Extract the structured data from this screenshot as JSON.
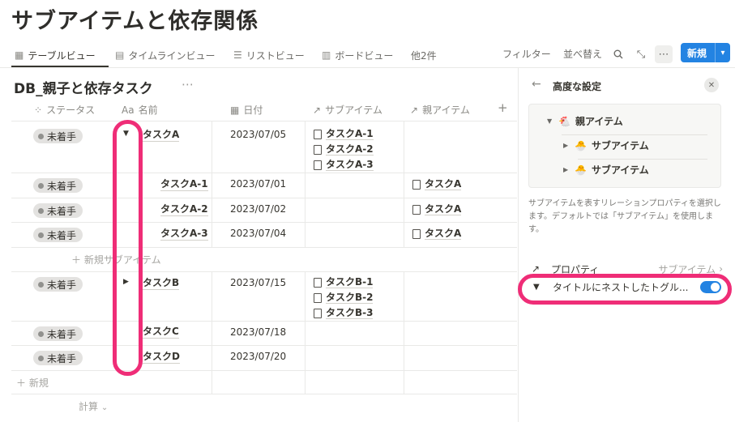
{
  "page": {
    "title": "サブアイテムと依存関係"
  },
  "views": {
    "tabs": [
      {
        "label": "テーブルビュー",
        "icon": "table-icon",
        "active": true
      },
      {
        "label": "タイムラインビュー",
        "icon": "timeline-icon"
      },
      {
        "label": "リストビュー",
        "icon": "list-icon"
      },
      {
        "label": "ボードビュー",
        "icon": "board-icon"
      }
    ],
    "more_views": "他2件",
    "filter_label": "フィルター",
    "sort_label": "並べ替え",
    "new_button_label": "新規"
  },
  "database": {
    "title": "DB_親子と依存タスク",
    "columns": [
      {
        "label": "ステータス",
        "icon": "status-icon"
      },
      {
        "label": "名前",
        "icon": "Aa"
      },
      {
        "label": "日付",
        "icon": "calendar-icon"
      },
      {
        "label": "サブアイテム",
        "icon": "relation-arrow-icon"
      },
      {
        "label": "親アイテム",
        "icon": "relation-arrow-icon"
      }
    ],
    "rows": [
      {
        "status": "未着手",
        "name": "タスクA",
        "date": "2023/07/05",
        "sub_items": [
          "タスクA-1",
          "タスクA-2",
          "タスクA-3"
        ],
        "parent": ""
      },
      {
        "status": "未着手",
        "name": "タスクA-1",
        "date": "2023/07/01",
        "sub_items": [],
        "parent": "タスクA"
      },
      {
        "status": "未着手",
        "name": "タスクA-2",
        "date": "2023/07/02",
        "sub_items": [],
        "parent": "タスクA"
      },
      {
        "status": "未着手",
        "name": "タスクA-3",
        "date": "2023/07/04",
        "sub_items": [],
        "parent": "タスクA"
      },
      {
        "status": "未着手",
        "name": "タスクB",
        "date": "2023/07/15",
        "sub_items": [
          "タスクB-1",
          "タスクB-2",
          "タスクB-3"
        ],
        "parent": ""
      },
      {
        "status": "未着手",
        "name": "タスクC",
        "date": "2023/07/18",
        "sub_items": [],
        "parent": ""
      },
      {
        "status": "未着手",
        "name": "タスクD",
        "date": "2023/07/20",
        "sub_items": [],
        "parent": ""
      }
    ],
    "new_sub_item_label": "新規サブアイテム",
    "new_row_label": "新規",
    "calc_label": "計算"
  },
  "panel": {
    "title": "高度な設定",
    "tree": {
      "parent": "親アイテム",
      "parent_icon": "🐔",
      "children": [
        "サブアイテム",
        "サブアイテム"
      ],
      "child_icon": "🐣"
    },
    "description": "サブアイテムを表すリレーションプロパティを選択します。デフォルトでは「サブアイテム」を使用します。",
    "property_label": "プロパティ",
    "property_value": "サブアイテム",
    "nest_label": "タイトルにネストしたトグル...",
    "nest_enabled": true
  },
  "colors": {
    "accent": "#2383e2",
    "highlight": "#ef2d77",
    "badge_bg": "#e3e2e0"
  }
}
